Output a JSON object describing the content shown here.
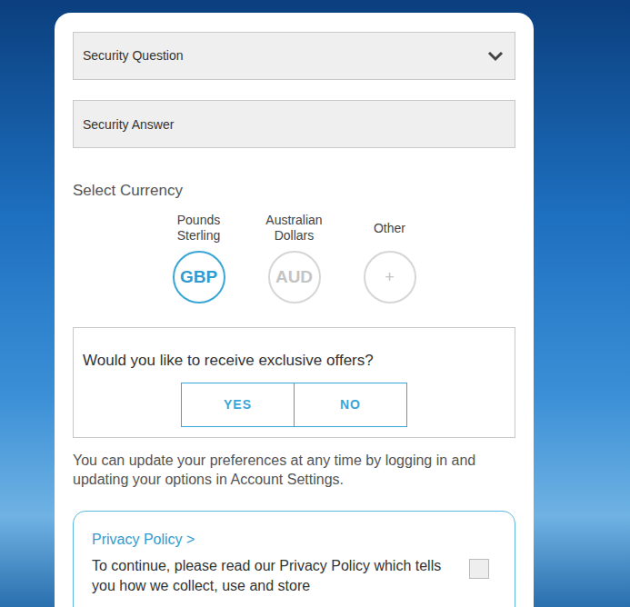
{
  "form": {
    "security_question": {
      "text": "Security Question"
    },
    "security_answer": {
      "placeholder": "Security Answer"
    }
  },
  "currency": {
    "title": "Select Currency",
    "options": [
      {
        "label": "Pounds Sterling",
        "code": "GBP",
        "selected": true
      },
      {
        "label": "Australian Dollars",
        "code": "AUD",
        "selected": false
      },
      {
        "label": "Other",
        "code": "+",
        "selected": false
      }
    ]
  },
  "offers": {
    "question": "Would you like to receive exclusive offers?",
    "options": [
      {
        "label": "YES",
        "selected": false
      },
      {
        "label": "NO",
        "selected": false
      }
    ]
  },
  "preferences_note": "You can update your preferences at any time by logging in and updating your options in Account Settings.",
  "privacy": {
    "link": "Privacy Policy >",
    "text": "To continue, please read our Privacy Policy which tells you how we collect, use and store",
    "checked": false
  }
}
